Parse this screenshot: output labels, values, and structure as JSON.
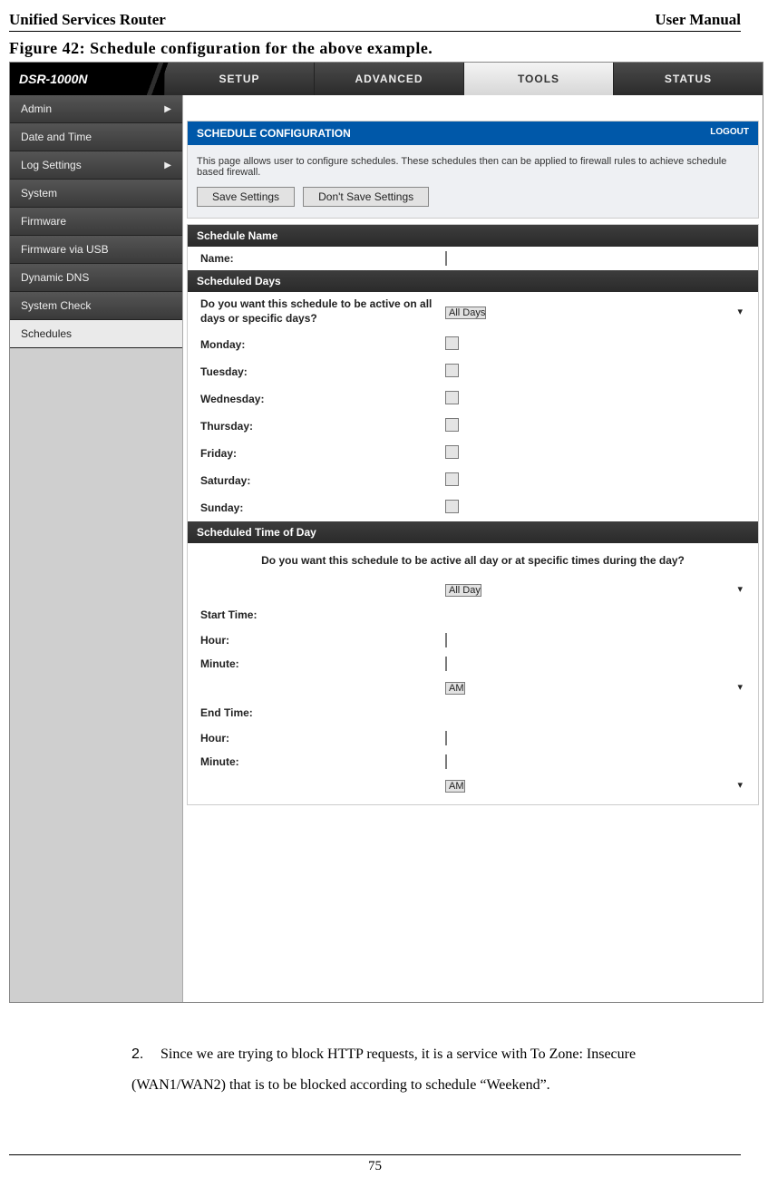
{
  "doc": {
    "header_left": "Unified Services Router",
    "header_right": "User Manual",
    "figure_caption": "Figure 42: Schedule configuration for the above example.",
    "list_num": "2.",
    "list_text": "Since we are trying to block HTTP requests, it is a service with To Zone: Insecure (WAN1/WAN2) that is to be blocked according to schedule “Weekend”.",
    "page_number": "75"
  },
  "topnav": {
    "logo": "DSR-1000N",
    "items": [
      "SETUP",
      "ADVANCED",
      "TOOLS",
      "STATUS"
    ],
    "active_index": 2
  },
  "sidebar": {
    "items": [
      {
        "label": "Admin",
        "arrow": true
      },
      {
        "label": "Date and Time"
      },
      {
        "label": "Log Settings",
        "arrow": true
      },
      {
        "label": "System"
      },
      {
        "label": "Firmware"
      },
      {
        "label": "Firmware via USB"
      },
      {
        "label": "Dynamic DNS"
      },
      {
        "label": "System Check"
      },
      {
        "label": "Schedules",
        "active": true
      }
    ]
  },
  "panel": {
    "title": "SCHEDULE CONFIGURATION",
    "logout": "LOGOUT",
    "desc": "This page allows user to configure schedules. These schedules then can be applied to firewall rules to achieve schedule based firewall.",
    "save_btn": "Save Settings",
    "dont_save_btn": "Don't Save Settings"
  },
  "sections": {
    "schedule_name": {
      "head": "Schedule Name",
      "name_label": "Name:"
    },
    "scheduled_days": {
      "head": "Scheduled Days",
      "question": "Do you want this schedule to be active on all days or specific days?",
      "select_value": "All Days",
      "days": [
        "Monday:",
        "Tuesday:",
        "Wednesday:",
        "Thursday:",
        "Friday:",
        "Saturday:",
        "Sunday:"
      ]
    },
    "scheduled_time": {
      "head": "Scheduled Time of Day",
      "question": "Do you want this schedule to be active all day or at specific times during the day?",
      "select_value": "All Day",
      "start_label": "Start Time:",
      "end_label": "End Time:",
      "hour_label": "Hour:",
      "minute_label": "Minute:",
      "ampm_value": "AM"
    }
  }
}
